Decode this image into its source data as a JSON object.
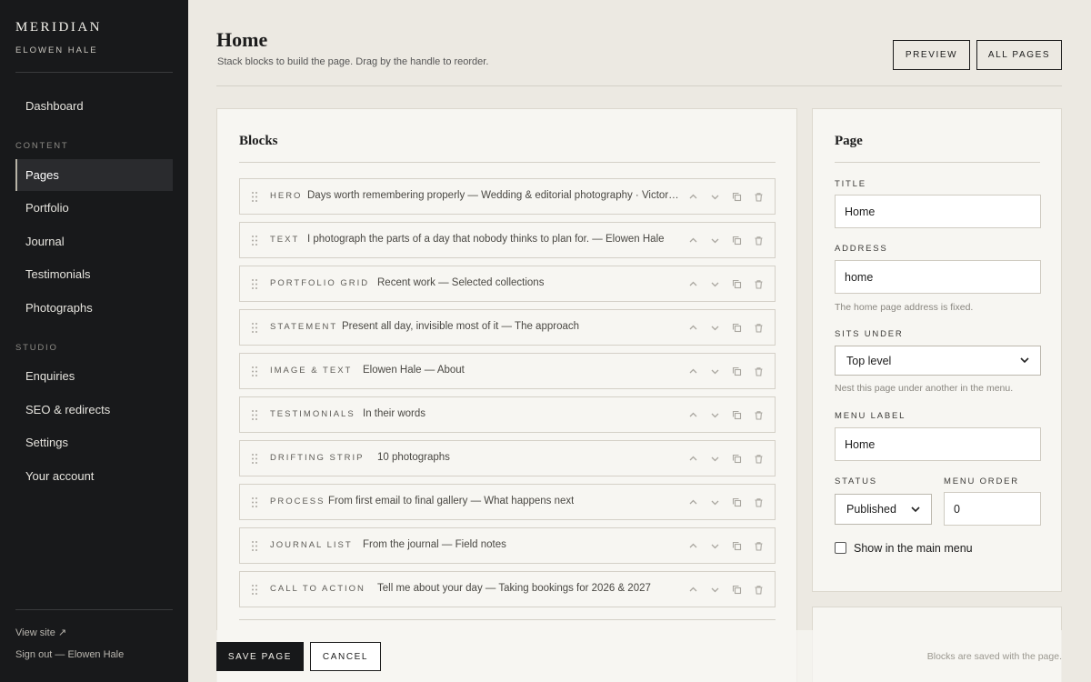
{
  "sidebar": {
    "brand": "MERIDIAN",
    "owner": "ELOWEN HALE",
    "items": [
      {
        "label": "Dashboard"
      },
      {
        "label": "Pages"
      },
      {
        "label": "Portfolio"
      },
      {
        "label": "Journal"
      },
      {
        "label": "Testimonials"
      },
      {
        "label": "Photographs"
      },
      {
        "label": "Enquiries"
      },
      {
        "label": "SEO & redirects"
      },
      {
        "label": "Settings"
      },
      {
        "label": "Your account"
      }
    ],
    "sections": {
      "content": "CONTENT",
      "studio": "STUDIO"
    },
    "active_item": "Pages",
    "view_site": "View site ↗",
    "sign_out": "Sign out — Elowen Hale"
  },
  "header": {
    "title": "Home",
    "subtitle": "Stack blocks to build the page. Drag by the handle to reorder.",
    "preview_label": "PREVIEW",
    "all_pages_label": "ALL PAGES"
  },
  "blocks_panel": {
    "title": "Blocks",
    "blocks": [
      {
        "type": "HERO",
        "summary": "Days worth remembering properly — Wedding & editorial photography · Victori…"
      },
      {
        "type": "TEXT",
        "summary": "I photograph the parts of a day that nobody thinks to plan for. — Elowen Hale"
      },
      {
        "type": "PORTFOLIO GRID",
        "summary": "Recent work — Selected collections"
      },
      {
        "type": "STATEMENT",
        "summary": "Present all day, invisible most of it — The approach"
      },
      {
        "type": "IMAGE & TEXT",
        "summary": "Elowen Hale — About"
      },
      {
        "type": "TESTIMONIALS",
        "summary": "In their words"
      },
      {
        "type": "DRIFTING STRIP",
        "summary": "10 photographs"
      },
      {
        "type": "PROCESS",
        "summary": "From first email to final gallery — What happens next"
      },
      {
        "type": "JOURNAL LIST",
        "summary": "From the journal — Field notes"
      },
      {
        "type": "CALL TO ACTION",
        "summary": "Tell me about your day — Taking bookings for 2026 & 2027"
      }
    ]
  },
  "page_panel": {
    "title": "Page",
    "title_label": "TITLE",
    "title_value": "Home",
    "address_label": "ADDRESS",
    "address_value": "home",
    "address_hint": "The home page address is fixed.",
    "sits_under_label": "SITS UNDER",
    "sits_under_value": "Top level",
    "sits_under_hint": "Nest this page under another in the menu.",
    "menu_label_label": "MENU LABEL",
    "menu_label_value": "Home",
    "status_label": "STATUS",
    "status_value": "Published",
    "menu_order_label": "MENU ORDER",
    "menu_order_value": "0",
    "show_in_menu_label": "Show in the main menu",
    "show_in_menu_checked": false
  },
  "footer": {
    "save_label": "SAVE PAGE",
    "cancel_label": "CANCEL",
    "note": "Blocks are saved with the page."
  },
  "icons": {
    "drag": "drag-handle-icon",
    "move_up": "chevron-up-icon",
    "move_down": "chevron-down-icon",
    "duplicate": "copy-icon",
    "delete": "trash-icon",
    "select": "chevron-down-icon"
  },
  "colors": {
    "sidebar_bg": "#18191b",
    "page_bg": "#ece9e2",
    "panel_bg": "#f7f6f2",
    "primary_button": "#17181a"
  }
}
